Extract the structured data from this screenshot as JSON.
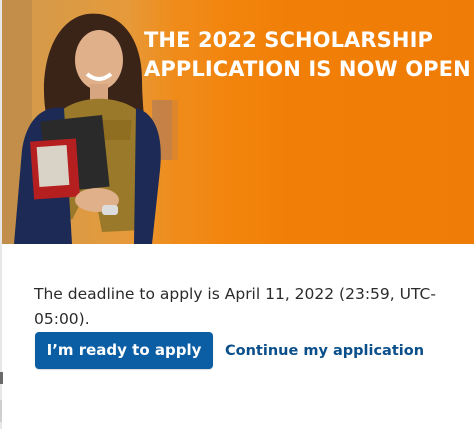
{
  "banner": {
    "headline_line1": "THE 2022 SCHOLARSHIP",
    "headline_line2": "APPLICATION IS NOW OPEN",
    "background_color": "#f17f07",
    "headline_color": "#ffffff"
  },
  "body": {
    "deadline_text": "The deadline to apply is April 11, 2022 (23:59, UTC-05:00)."
  },
  "actions": {
    "apply_label": "I’m ready to apply",
    "apply_color": "#0b5ea3",
    "continue_label": "Continue my application",
    "continue_color": "#0b4f8a"
  }
}
